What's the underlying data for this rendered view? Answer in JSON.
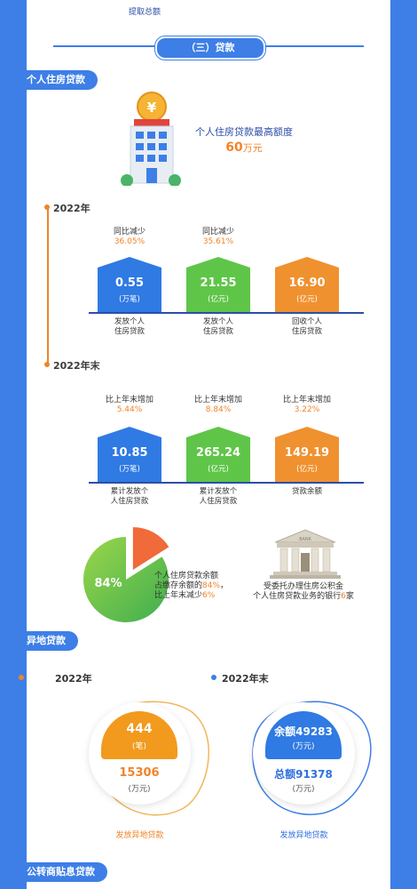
{
  "top_text": "提取总额",
  "section_title": "（三）贷款",
  "tags": {
    "personal": "个人住房贷款",
    "offsite": "异地贷款",
    "subsidy": "公转商贴息贷款"
  },
  "max_limit": {
    "label": "个人住房贷款最高额度",
    "value": "60",
    "unit": "万元"
  },
  "year_2022": {
    "label": "2022年",
    "bars": [
      {
        "change_label": "同比减少",
        "change_value": "36.05%",
        "value": "0.55",
        "unit": "(万笔)",
        "caption1": "发放个人",
        "caption2": "住房贷款",
        "color": "#2f7ae3"
      },
      {
        "change_label": "同比减少",
        "change_value": "35.61%",
        "value": "21.55",
        "unit": "(亿元)",
        "caption1": "发放个人",
        "caption2": "住房贷款",
        "color": "#5fc548"
      },
      {
        "change_label": "",
        "change_value": "",
        "value": "16.90",
        "unit": "(亿元)",
        "caption1": "回收个人",
        "caption2": "住房贷款",
        "color": "#f0912f"
      }
    ]
  },
  "year_2022_end": {
    "label": "2022年末",
    "bars": [
      {
        "change_label": "比上年末增加",
        "change_value": "5.44%",
        "value": "10.85",
        "unit": "(万笔)",
        "caption1": "累计发放个",
        "caption2": "人住房贷款",
        "color": "#2f7ae3"
      },
      {
        "change_label": "比上年末增加",
        "change_value": "8.84%",
        "value": "265.24",
        "unit": "(亿元)",
        "caption1": "累计发放个",
        "caption2": "人住房贷款",
        "color": "#5fc548"
      },
      {
        "change_label": "比上年末增加",
        "change_value": "3.22%",
        "value": "149.19",
        "unit": "(亿元)",
        "caption1": "贷款余额",
        "caption2": "",
        "color": "#f0912f"
      }
    ]
  },
  "ratio": {
    "percent_label": "84%",
    "percent": 84,
    "line1": "个人住房贷款余额",
    "line2_prefix": "占缴存余额的",
    "line2_value": "84%",
    "line2_suffix": "，",
    "line3_prefix": "比上年末减少",
    "line3_value": "6%"
  },
  "bank": {
    "sign": "BANK",
    "line1": "受委托办理住房公积金",
    "line2_prefix": "个人住房贷款业务的银行",
    "line2_value": "6",
    "line2_suffix": "家"
  },
  "offsite": {
    "left": {
      "year": "2022年",
      "top_value": "444",
      "top_unit": "(笔)",
      "bottom_value": "15306",
      "bottom_unit": "(万元)",
      "caption": "发放异地贷款"
    },
    "right": {
      "year": "2022年末",
      "top_prefix": "余额",
      "top_value": "49283",
      "top_unit": "(万元)",
      "bottom_prefix": "总额",
      "bottom_value": "91378",
      "bottom_unit": "(万元)",
      "caption": "发放异地贷款"
    }
  },
  "colors": {
    "blue": "#2f7ae3",
    "green": "#5fc548",
    "orange": "#f0912f",
    "background": "#3d7fe6"
  }
}
